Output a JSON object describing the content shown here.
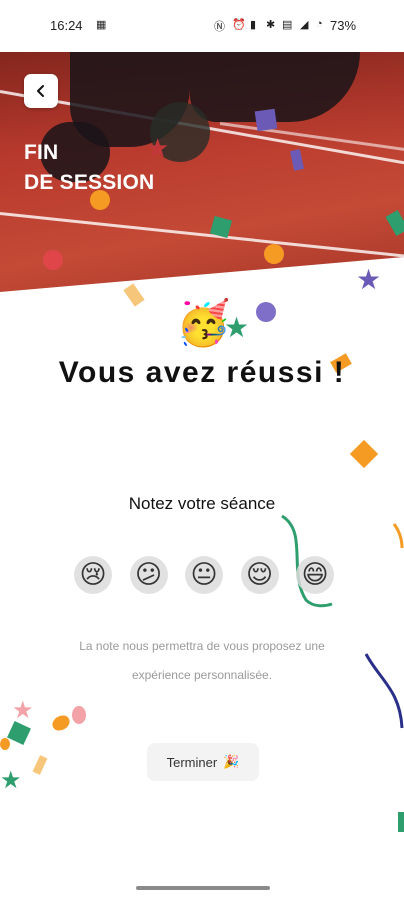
{
  "status_bar": {
    "time": "16:24",
    "battery": "73%"
  },
  "header": {
    "back_icon": "chevron-left-icon",
    "title_line1": "FIN",
    "title_line2": "DE SESSION"
  },
  "main": {
    "party_emoji": "🥳",
    "title": "Vous avez réussi !",
    "rate_label": "Notez votre séance",
    "ratings": [
      {
        "emoji": "😢",
        "icon": "sad-face-icon"
      },
      {
        "emoji": "😕",
        "icon": "confused-face-icon"
      },
      {
        "emoji": "😐",
        "icon": "neutral-face-icon"
      },
      {
        "emoji": "😌",
        "icon": "relieved-face-icon"
      },
      {
        "emoji": "😄",
        "icon": "happy-face-icon"
      }
    ],
    "hint_line1": "La note nous permettra de vous proposez une",
    "hint_line2": "expérience personnalisée.",
    "finish_label": "Terminer",
    "finish_emoji": "🎉"
  },
  "colors": {
    "confetti": [
      "#f59a23",
      "#2e9e6e",
      "#6b5bb7",
      "#e0454a",
      "#f6c67a",
      "#f3a2a7"
    ],
    "hero": "#b8392d"
  }
}
